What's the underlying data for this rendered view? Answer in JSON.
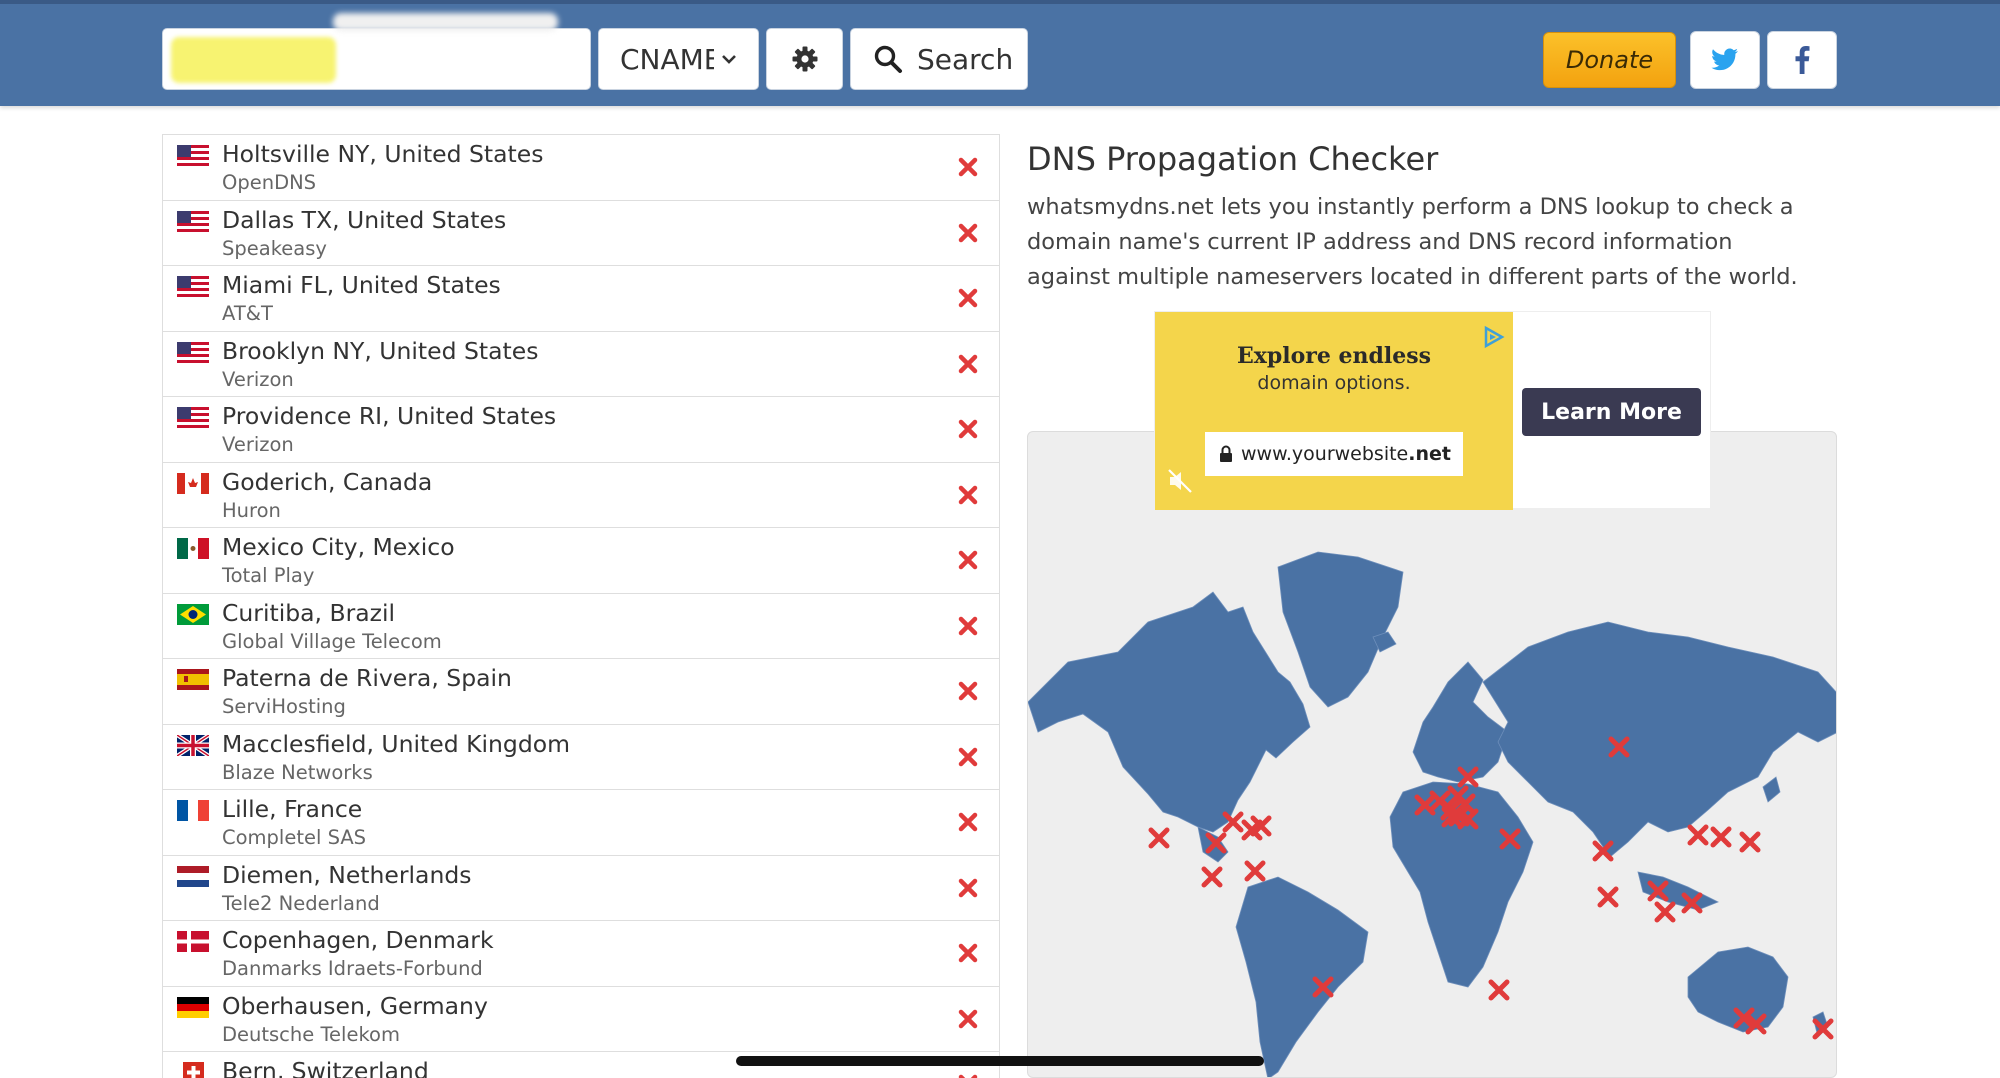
{
  "header": {
    "domain_value": "",
    "record_type": "CNAME",
    "search_label": "Search",
    "donate_label": "Donate"
  },
  "results": [
    {
      "location": "Holtsville NY, United States",
      "provider": "OpenDNS",
      "flag": "us"
    },
    {
      "location": "Dallas TX, United States",
      "provider": "Speakeasy",
      "flag": "us"
    },
    {
      "location": "Miami FL, United States",
      "provider": "AT&T",
      "flag": "us"
    },
    {
      "location": "Brooklyn NY, United States",
      "provider": "Verizon",
      "flag": "us"
    },
    {
      "location": "Providence RI, United States",
      "provider": "Verizon",
      "flag": "us"
    },
    {
      "location": "Goderich, Canada",
      "provider": "Huron",
      "flag": "ca"
    },
    {
      "location": "Mexico City, Mexico",
      "provider": "Total Play",
      "flag": "mx"
    },
    {
      "location": "Curitiba, Brazil",
      "provider": "Global Village Telecom",
      "flag": "br"
    },
    {
      "location": "Paterna de Rivera, Spain",
      "provider": "ServiHosting",
      "flag": "es"
    },
    {
      "location": "Macclesfield, United Kingdom",
      "provider": "Blaze Networks",
      "flag": "gb"
    },
    {
      "location": "Lille, France",
      "provider": "Completel SAS",
      "flag": "fr"
    },
    {
      "location": "Diemen, Netherlands",
      "provider": "Tele2 Nederland",
      "flag": "nl"
    },
    {
      "location": "Copenhagen, Denmark",
      "provider": "Danmarks Idraets-Forbund",
      "flag": "dk"
    },
    {
      "location": "Oberhausen, Germany",
      "provider": "Deutsche Telekom",
      "flag": "de"
    },
    {
      "location": "Bern, Switzerland",
      "provider": "",
      "flag": "ch"
    }
  ],
  "info": {
    "title": "DNS Propagation Checker",
    "description": "whatsmydns.net lets you instantly perform a DNS lookup to check a domain name's current IP address and DNS record information against multiple nameservers located in different parts of the world."
  },
  "ad": {
    "headline": "Explore endless",
    "subline": "domain options.",
    "url_prefix": "www.yourwebsite",
    "url_suffix": ".net",
    "cta": "Learn More"
  },
  "icons": {
    "gear": "gear-icon",
    "search": "search-icon",
    "twitter": "twitter-icon",
    "facebook": "facebook-icon",
    "status_fail": "red-x-icon"
  },
  "colors": {
    "header_bg": "#4a72a4",
    "map_land": "#4a72a4",
    "fail_red": "#e03b3b",
    "donate": "#f5b21a"
  }
}
